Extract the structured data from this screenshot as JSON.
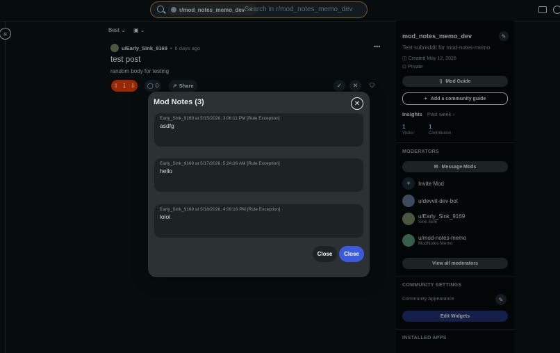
{
  "header": {
    "search_chip": "r/mod_notes_memo_dev",
    "search_placeholder": "Search in r/mod_notes_memo_dev"
  },
  "feed": {
    "sort_label": "Best",
    "post": {
      "author": "u/Early_Sink_9169",
      "separator": "•",
      "time": "6 days ago",
      "title": "test post",
      "body": "random body for testing",
      "score": "1",
      "comments": "0",
      "share_label": "Share"
    }
  },
  "sidebar": {
    "name": "mod_notes_memo_dev",
    "description": "Test subreddit for mod-notes-memo",
    "created": "Created May 12, 2026",
    "privacy": "Private",
    "mod_guide": "Mod Guide",
    "add_guide": "Add a community guide",
    "insights_label": "Insights",
    "insights_period": "Past week",
    "stats": [
      {
        "value": "1",
        "label": "Visitor"
      },
      {
        "value": "1",
        "label": "Contribution"
      }
    ],
    "moderators_heading": "MODERATORS",
    "message_mods": "Message Mods",
    "invite_mod": "Invite Mod",
    "moderators": [
      {
        "name": "u/devvit-dev-bot",
        "sub": "",
        "color": "#5a6a8a"
      },
      {
        "name": "u/Early_Sink_9169",
        "sub": "Sink Sink",
        "color": "#6b7c5a"
      },
      {
        "name": "u/mod-notes-memo",
        "sub": "ModNotes Memo",
        "color": "#4f8a6a"
      }
    ],
    "view_all": "View all moderators",
    "settings_heading": "COMMUNITY SETTINGS",
    "appearance": "Community Appearance",
    "edit_widgets": "Edit Widgets",
    "apps_heading": "INSTALLED APPS"
  },
  "modal": {
    "title": "Mod Notes (3)",
    "notes": [
      {
        "meta": "Early_Sink_9169 at 5/15/2026, 3:06:11 PM [Rule Exception]",
        "body": "asdfg"
      },
      {
        "meta": "Early_Sink_9169 at 5/17/2026, 5:24:26 AM [Rule Exception]",
        "body": "hello"
      },
      {
        "meta": "Early_Sink_9169 at 5/18/2026, 4:09:16 PM [Rule Exception]",
        "body": "lolol"
      }
    ],
    "close_secondary": "Close",
    "close_primary": "Close"
  },
  "colors": {
    "accent_orange": "#d93a00",
    "primary_blue": "#3b5bdb",
    "background": "#0b1416"
  }
}
